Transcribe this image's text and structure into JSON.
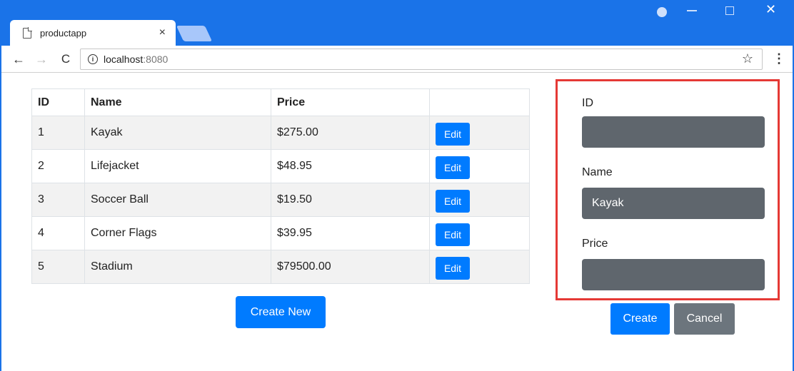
{
  "browser": {
    "tab_title": "productapp",
    "tab_close": "×",
    "url_host": "localhost",
    "url_port": ":8080",
    "info_glyph": "i",
    "star_glyph": "☆",
    "menu_glyph": "⋮",
    "back_glyph": "←",
    "forward_glyph": "→",
    "reload_glyph": "C",
    "win_close_glyph": "✕",
    "accent_color": "#1a73e8"
  },
  "table": {
    "headers": [
      "ID",
      "Name",
      "Price",
      ""
    ],
    "rows": [
      {
        "id": "1",
        "name": "Kayak",
        "price": "$275.00",
        "action": "Edit"
      },
      {
        "id": "2",
        "name": "Lifejacket",
        "price": "$48.95",
        "action": "Edit"
      },
      {
        "id": "3",
        "name": "Soccer Ball",
        "price": "$19.50",
        "action": "Edit"
      },
      {
        "id": "4",
        "name": "Corner Flags",
        "price": "$39.95",
        "action": "Edit"
      },
      {
        "id": "5",
        "name": "Stadium",
        "price": "$79500.00",
        "action": "Edit"
      }
    ]
  },
  "create_new_label": "Create New",
  "form": {
    "id_label": "ID",
    "id_value": "",
    "name_label": "Name",
    "name_value": "Kayak",
    "price_label": "Price",
    "price_value": "",
    "create_label": "Create",
    "cancel_label": "Cancel",
    "highlight_color": "#e53935"
  }
}
